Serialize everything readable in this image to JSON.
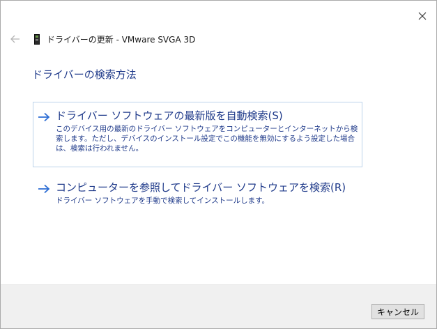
{
  "window": {
    "title": "ドライバーの更新 - VMware SVGA 3D",
    "close_icon": "close-icon",
    "back_icon": "back-arrow-icon",
    "device_icon": "display-adapter-icon"
  },
  "page": {
    "heading": "ドライバーの検索方法"
  },
  "options": [
    {
      "title": "ドライバー ソフトウェアの最新版を自動検索(S)",
      "description": "このデバイス用の最新のドライバー ソフトウェアをコンピューターとインターネットから検索します。ただし、デバイスのインストール設定でこの機能を無効にするよう設定した場合は、検索は行われません。",
      "icon": "arrow-right-icon"
    },
    {
      "title": "コンピューターを参照してドライバー ソフトウェアを検索(R)",
      "description": "ドライバー ソフトウェアを手動で検索してインストールします。",
      "icon": "arrow-right-icon"
    }
  ],
  "footer": {
    "cancel_label": "キャンセル"
  },
  "colors": {
    "accent": "#1f3a8a",
    "arrow": "#2b6cd4",
    "option_border": "#bcd3ea",
    "footer_bg": "#f0f0f0"
  }
}
